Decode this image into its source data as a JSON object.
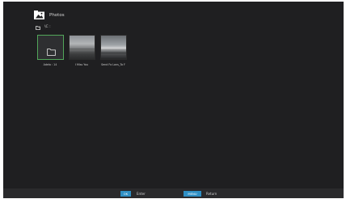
{
  "header": {
    "title": "Photos",
    "icon": "photos-icon"
  },
  "breadcrumb": {
    "icon": "folder-icon",
    "path": "\\C :"
  },
  "items": [
    {
      "type": "folder",
      "label": "Adela : 14",
      "icon": "folder-icon",
      "selected": true
    },
    {
      "type": "photo",
      "label": "I Miss You"
    },
    {
      "type": "photo",
      "label": "Send Fo Lons_To F"
    }
  ],
  "footer": {
    "ok_key": "OK",
    "ok_action": "Enter",
    "menu_key": "MENU",
    "menu_action": "Return"
  },
  "colors": {
    "background": "#1f1f21",
    "selection": "#52a65a",
    "key_accent": "#2f8fc4"
  }
}
